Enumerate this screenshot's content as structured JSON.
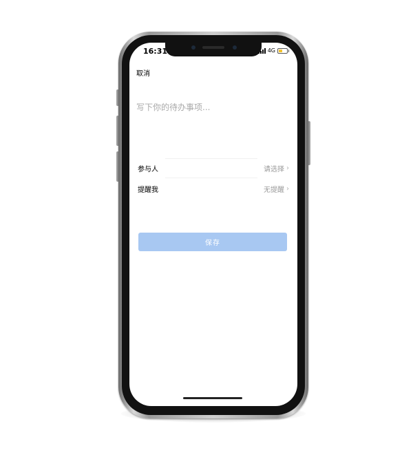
{
  "status_bar": {
    "time": "16:31",
    "network": "4G"
  },
  "header": {
    "cancel_label": "取消"
  },
  "todo": {
    "placeholder": "写下你的待办事项..."
  },
  "form": {
    "participants": {
      "label": "参与人",
      "value": "请选择"
    },
    "reminder": {
      "label": "提醒我",
      "value": "无提醒"
    }
  },
  "actions": {
    "save_label": "保存"
  },
  "colors": {
    "save_button": "#a8c8f2",
    "battery": "#f2c230"
  },
  "icons": {
    "row_chevron": "chevron-right-icon",
    "signal": "signal-icon",
    "battery": "battery-icon"
  }
}
